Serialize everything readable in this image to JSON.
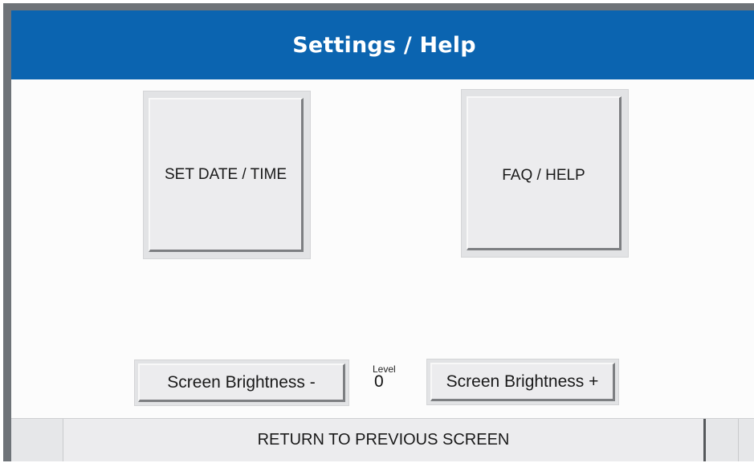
{
  "header": {
    "title": "Settings / Help"
  },
  "buttons": {
    "set_date_time": "SET DATE / TIME",
    "faq_help": "FAQ / HELP",
    "brightness_down": "Screen Brightness -",
    "brightness_up": "Screen Brightness +",
    "return": "RETURN TO PREVIOUS SCREEN"
  },
  "brightness": {
    "level_label": "Level",
    "level_value": "0"
  },
  "colors": {
    "header_bg": "#0b64b0",
    "frame": "#6e7378",
    "button_face": "#ececee"
  }
}
